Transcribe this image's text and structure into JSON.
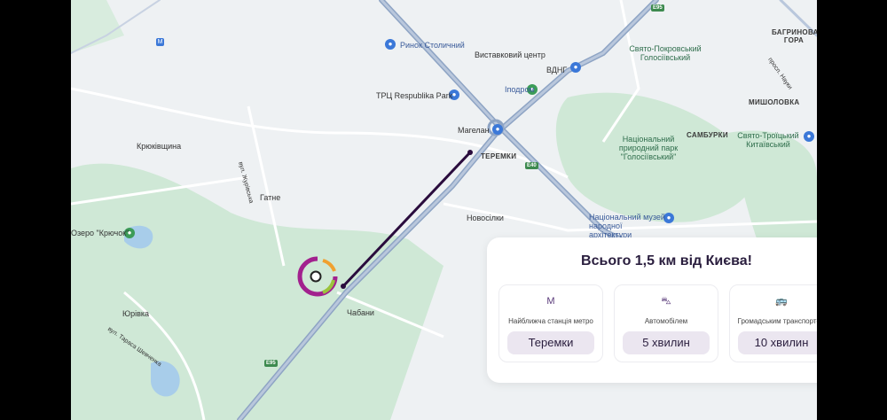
{
  "map": {
    "labels": {
      "market": "Ринок Столичний",
      "expo": "Виставковий центр",
      "vdng": "ВДНГ",
      "mall": "ТРЦ Respublika Park",
      "ipodrom": "Іподром",
      "magelan": "Магелан",
      "teremky": "ТЕРЕМКИ",
      "kriukivshchyna": "Крюківщина",
      "zhurivska": "вул. Журівська",
      "hatne": "Гатне",
      "novosilky": "Новосілки",
      "lake": "Озеро \"Крючок\"",
      "yurivka": "Юрівка",
      "shevchenka": "вул. Тараса Шевченка",
      "chabany": "Чабани",
      "pokrovsky": "Свято-Покровський Голосіївський",
      "park": "Національний природний парк \"Голосіївський\"",
      "samburky": "САМБУРКИ",
      "troitsky": "Свято-Троїцький Китаївський",
      "misholovka": "МИШОЛОВКА",
      "bahrynova": "БАГРИНОВА ГОРА",
      "nauky": "просп. Науки",
      "museum": "Національний музей народної архітектури",
      "e95": "E95",
      "e40": "E40"
    },
    "colors": {
      "route": "#2a0c3d",
      "logo_purple": "#a2218e",
      "logo_orange": "#f0a030",
      "logo_green": "#9bc33c",
      "park": "#cfe8d6"
    }
  },
  "card": {
    "title": "Всього 1,5 км від Києва!",
    "options": [
      {
        "icon": "metro-icon",
        "glyph": "M",
        "caption": "Найближча станція метро",
        "value": "Теремки"
      },
      {
        "icon": "car-icon",
        "glyph": "⛍",
        "caption": "Автомобілем",
        "value": "5 хвилин"
      },
      {
        "icon": "bus-icon",
        "glyph": "🚌",
        "caption": "Громадським транспортом",
        "value": "10 хвилин"
      }
    ]
  }
}
